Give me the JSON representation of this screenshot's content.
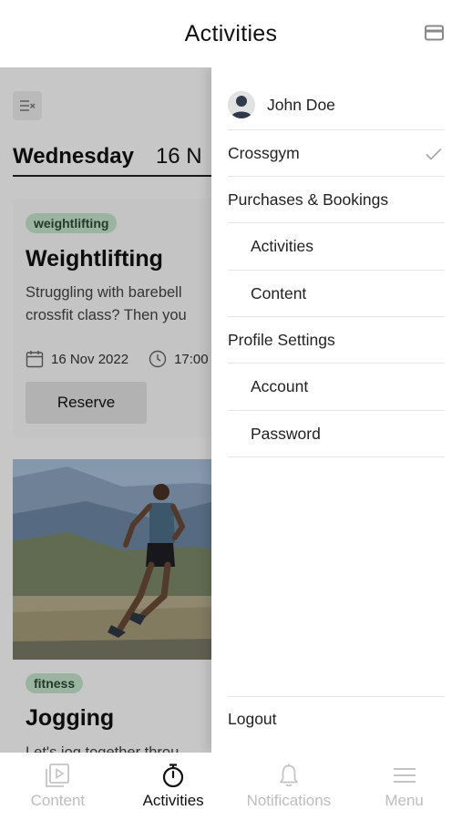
{
  "header": {
    "title": "Activities",
    "right_icon": "card-icon"
  },
  "schedule": {
    "day_name": "Wednesday",
    "day_date": "16 N",
    "activities": [
      {
        "tag": "weightlifting",
        "title": "Weightlifting",
        "description_lines": [
          "Struggling with barebell",
          "crossfit class? Then you"
        ],
        "date": "16 Nov 2022",
        "time": "17:00",
        "button_label": "Reserve"
      },
      {
        "tag": "fitness",
        "title": "Jogging",
        "description_lines": [
          "Let's jog together throu"
        ]
      }
    ]
  },
  "drawer": {
    "user_name": "John Doe",
    "gym_name": "Crossgym",
    "items": [
      {
        "label": "Purchases & Bookings"
      },
      {
        "label": "Activities"
      },
      {
        "label": "Content"
      },
      {
        "label": "Profile Settings"
      },
      {
        "label": "Account"
      },
      {
        "label": "Password"
      }
    ],
    "logout_label": "Logout"
  },
  "bottom_nav": {
    "items": [
      {
        "label": "Content",
        "icon": "play-icon",
        "active": false
      },
      {
        "label": "Activities",
        "icon": "stopwatch-icon",
        "active": true
      },
      {
        "label": "Notifications",
        "icon": "bell-icon",
        "active": false
      },
      {
        "label": "Menu",
        "icon": "hamburger-icon",
        "active": false
      }
    ]
  },
  "colors": {
    "tag_bg": "#c6e7cf",
    "tag_text": "#2e4a35",
    "inactive_nav": "#bdbdbd",
    "active_nav": "#111111"
  }
}
